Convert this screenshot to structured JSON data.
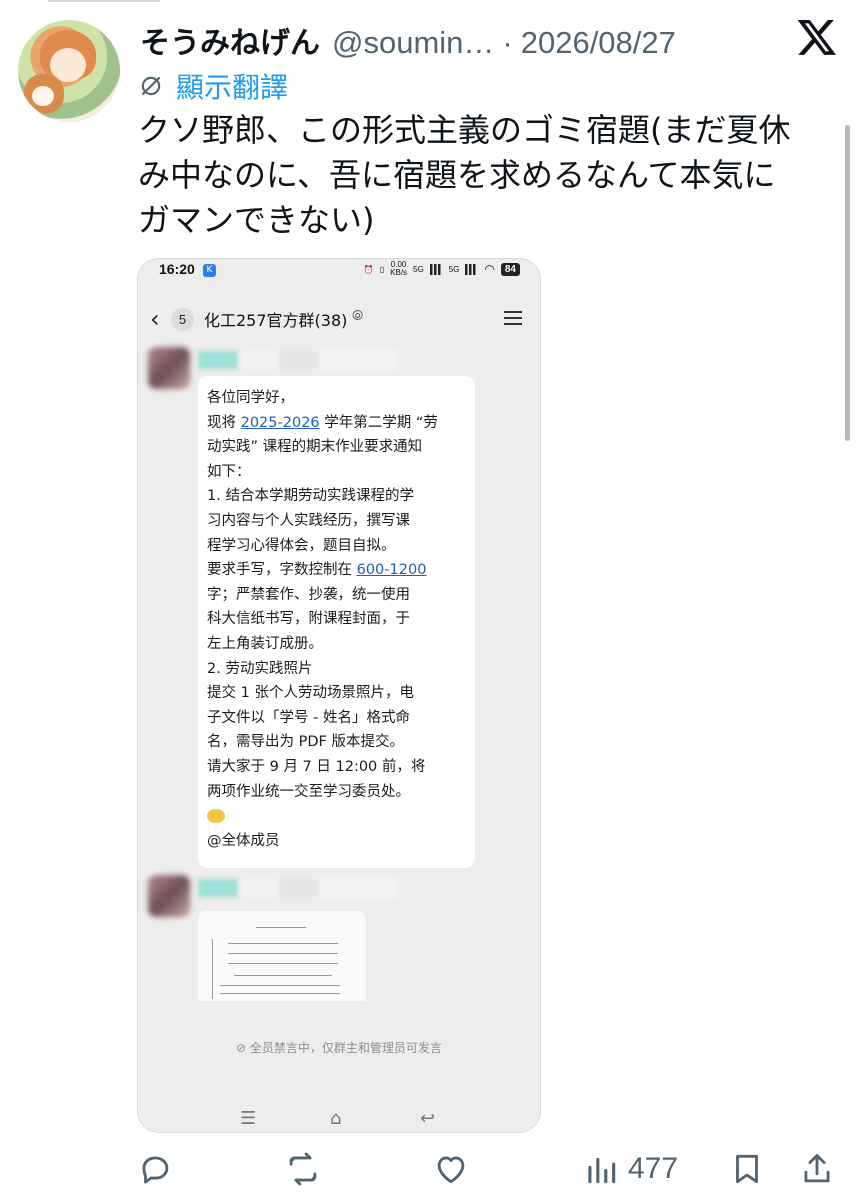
{
  "tweet": {
    "author_name": "そうみねげん",
    "handle": "@soumin…",
    "separator": "·",
    "date": "2026/08/27",
    "translate_label": "顯示翻譯",
    "text_lines": [
      "クソ野郎、この形式主義のゴミ宿題(まだ夏休",
      "み中なのに、吾に宿題を求めるなんて本気に",
      "ガマンできない)"
    ],
    "icons": {
      "platform": "x-logo-icon",
      "translate": "globe-slash-icon"
    }
  },
  "screenshot": {
    "status_time": "16:20",
    "status_app_badge": "K",
    "status_net_top": "0.00",
    "status_net_unit": "KB/s",
    "status_sig1": "5G",
    "status_sig2": "5G",
    "battery": "84",
    "unread_count": "5",
    "group_name": "化工257官方群(38)",
    "message_lines": [
      {
        "text": "各位同学好，"
      },
      {
        "pre": "现将 ",
        "link": "2025-2026",
        "post": " 学年第二学期 “劳"
      },
      {
        "text": "动实践” 课程的期末作业要求通知"
      },
      {
        "text": "如下："
      },
      {
        "text": "1. 结合本学期劳动实践课程的学"
      },
      {
        "text": "习内容与个人实践经历，撰写课"
      },
      {
        "text": "程学习心得体会，题目自拟。"
      },
      {
        "pre": "要求手写，字数控制在 ",
        "link": "600-1200",
        "post": ""
      },
      {
        "text": "字；严禁套作、抄袭，统一使用"
      },
      {
        "text": "科大信纸书写，附课程封面，于"
      },
      {
        "text": "左上角装订成册。"
      },
      {
        "text": "2. 劳动实践照片"
      },
      {
        "text": "提交 1 张个人劳动场景照片，电"
      },
      {
        "text": "子文件以「学号 - 姓名」格式命"
      },
      {
        "text": "名，需导出为 PDF 版本提交。"
      },
      {
        "text": "请大家于 9 月 7 日 12:00 前，将"
      },
      {
        "text": "两项作业统一交至学习委员处。"
      }
    ],
    "mention": "@全体成员",
    "muted_notice": "全员禁言中，仅群主和管理员可发言"
  },
  "actions": {
    "views": "477",
    "icons": [
      "reply-icon",
      "retweet-icon",
      "like-icon",
      "views-icon",
      "bookmark-icon",
      "share-icon"
    ]
  },
  "colors": {
    "link_blue": "#1d9bf0",
    "text": "#0f1419",
    "muted": "#536471"
  }
}
